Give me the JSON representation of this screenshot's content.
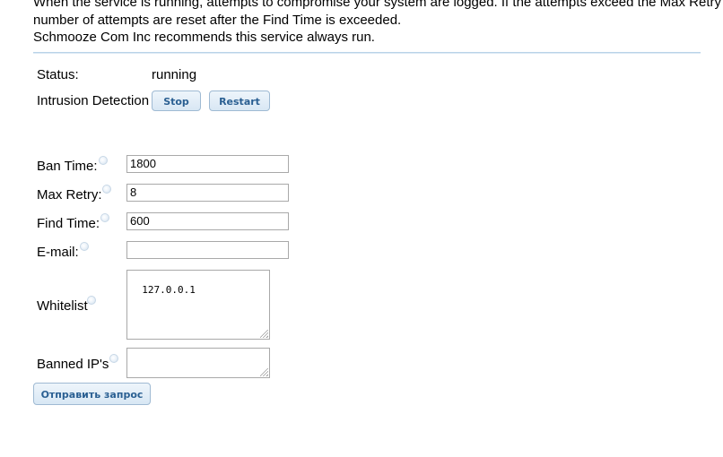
{
  "intro": {
    "line1": "When the service is running, attempts to compromise your system are logged. If the attempts exceed the Max Retry limit,",
    "line2": "number of attempts are reset after the Find Time is exceeded.",
    "line3": "Schmooze Com Inc recommends this service always run."
  },
  "status": {
    "label": "Status:",
    "value": "running"
  },
  "intrusion": {
    "label": "Intrusion Detection",
    "stop_label": "Stop",
    "restart_label": "Restart"
  },
  "form": {
    "ban_time": {
      "label": "Ban Time:",
      "value": "1800"
    },
    "max_retry": {
      "label": "Max Retry:",
      "value": "8"
    },
    "find_time": {
      "label": "Find Time:",
      "value": "600"
    },
    "email": {
      "label": "E-mail:",
      "value": ""
    },
    "whitelist": {
      "label": "Whitelist",
      "value": "127.0.0.1"
    },
    "banned_ips": {
      "label": "Banned IP's",
      "value": ""
    },
    "submit_label": "Отправить запрос"
  },
  "icons": {
    "help": "help-icon",
    "resize": "resize-grip-icon"
  },
  "colors": {
    "button_text": "#2a5f92",
    "button_border": "#9fbad3",
    "rule": "#b9d3e8"
  }
}
